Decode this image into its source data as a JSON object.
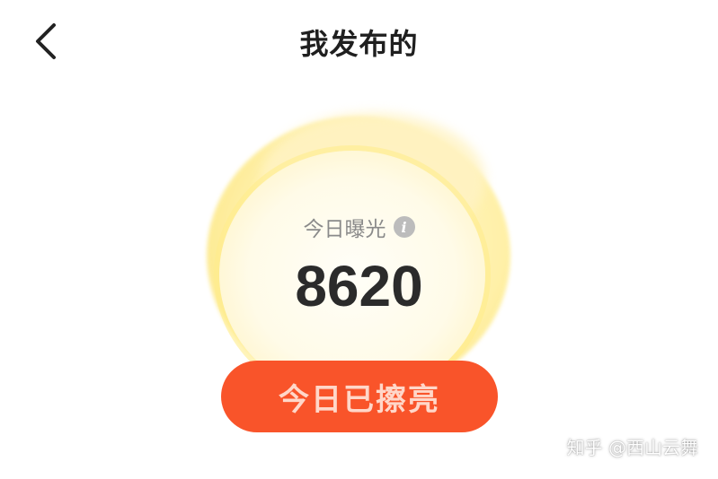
{
  "header": {
    "title": "我发布的",
    "back_icon": "chevron-left-icon"
  },
  "stats": {
    "exposure_label": "今日曝光",
    "info_icon": "i",
    "exposure_value": "8620"
  },
  "action": {
    "button_label": "今日已擦亮"
  },
  "watermark": {
    "text": "知乎 @西山云舞"
  },
  "colors": {
    "button_bg": "#f9542a",
    "button_text": "#ffd7c9",
    "glow": "#ffef9f",
    "title": "#1f1f1f",
    "label": "#8a8a8a",
    "value": "#2b2b2b"
  }
}
